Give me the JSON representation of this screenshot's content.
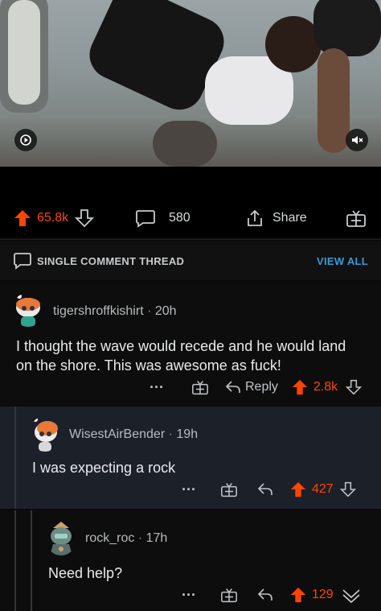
{
  "post": {
    "upvotes": "65.8k",
    "comments": "580",
    "share_label": "Share"
  },
  "thread": {
    "label": "SINGLE COMMENT THREAD",
    "view_all": "VIEW ALL"
  },
  "comments": [
    {
      "author": "tigershroffkishirt",
      "time": "20h",
      "body": "I thought the wave would recede and he would land on the shore. This was awesome as fuck!",
      "more": "···",
      "reply": "Reply",
      "score": "2.8k"
    },
    {
      "author": "WisestAirBender",
      "time": "19h",
      "body": "I was expecting a rock",
      "more": "···",
      "score": "427"
    },
    {
      "author": "rock_roc",
      "time": "17h",
      "body": "Need help?",
      "more": "···",
      "score": "129"
    }
  ],
  "colors": {
    "accent": "#ff4500",
    "link": "#3a9ad9",
    "reply_bg": "#1c2029"
  }
}
